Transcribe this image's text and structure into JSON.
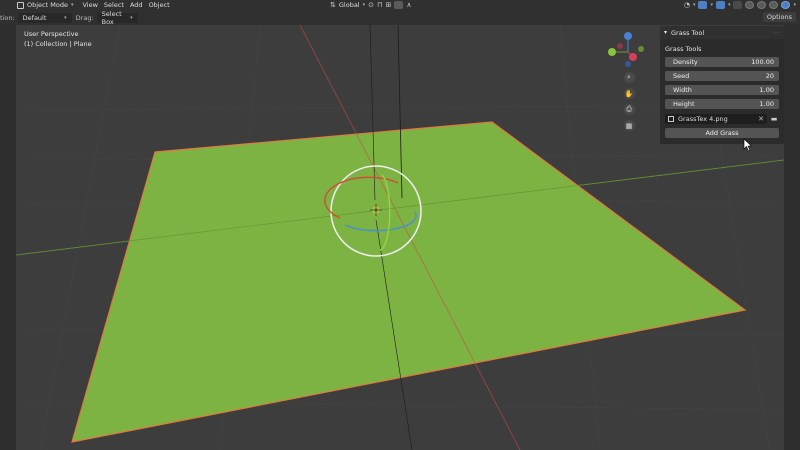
{
  "header": {
    "mode": "Object Mode",
    "menus": [
      "View",
      "Select",
      "Add",
      "Object"
    ],
    "transform_orientation": "Global"
  },
  "toolbar": {
    "orientation_label": "tion:",
    "orientation_value": "Default",
    "drag_label": "Drag:",
    "drag_value": "Select Box",
    "options_label": "Options"
  },
  "viewport": {
    "perspective": "User Perspective",
    "collection": "(1) Collection | Plane"
  },
  "panel": {
    "title": "Grass Tool",
    "subpanel_title": "Grass Tools",
    "properties": [
      {
        "label": "Density",
        "value": "100.00"
      },
      {
        "label": "Seed",
        "value": "20"
      },
      {
        "label": "Width",
        "value": "1.00"
      },
      {
        "label": "Height",
        "value": "1.00"
      }
    ],
    "texture_file": "GrassTex 4.png",
    "add_button": "Add Grass"
  },
  "gizmo": {
    "z_label": "Z",
    "y_label": "Y",
    "x_label": "X"
  },
  "colors": {
    "plane": "#7cb342",
    "plane_edge": "#e07a40",
    "x_axis": "#c84a4a",
    "y_axis": "#6a9a3a",
    "z_axis": "#4a7fd6"
  }
}
